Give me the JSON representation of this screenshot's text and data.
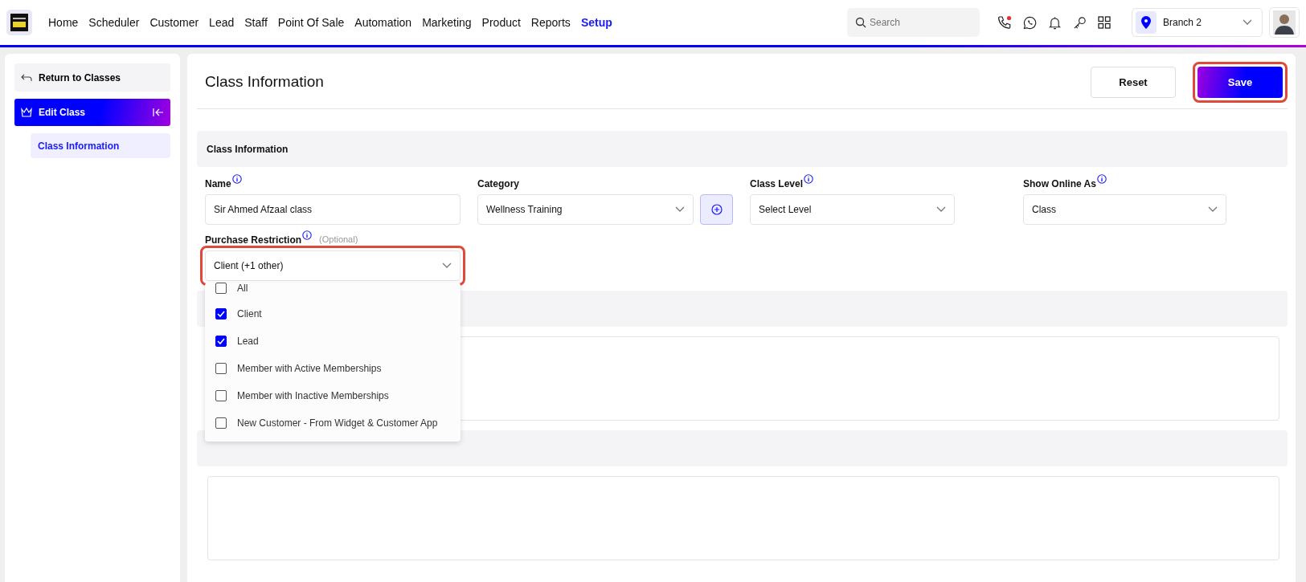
{
  "nav": {
    "items": [
      {
        "label": "Home",
        "selected": false
      },
      {
        "label": "Scheduler",
        "selected": false
      },
      {
        "label": "Customer",
        "selected": false
      },
      {
        "label": "Lead",
        "selected": false
      },
      {
        "label": "Staff",
        "selected": false
      },
      {
        "label": "Point Of Sale",
        "selected": false
      },
      {
        "label": "Automation",
        "selected": false
      },
      {
        "label": "Marketing",
        "selected": false
      },
      {
        "label": "Product",
        "selected": false
      },
      {
        "label": "Reports",
        "selected": false
      },
      {
        "label": "Setup",
        "selected": true
      }
    ],
    "search": {
      "placeholder": "Search"
    },
    "call_notification": true,
    "branch": "Branch 2"
  },
  "sidebar": {
    "back": "Return to Classes",
    "section": "Edit Class",
    "items": [
      {
        "label": "Class Information",
        "selected": true
      }
    ]
  },
  "page": {
    "title": "Class Information",
    "buttons": [
      {
        "label": "Reset",
        "kind": "secondary"
      },
      {
        "label": "Save",
        "kind": "primary",
        "highlighted": true
      }
    ]
  },
  "form": {
    "section": "Class Information",
    "fields": [
      {
        "label": "Name",
        "info": true,
        "kind": "text",
        "value": "Sir Ahmed Afzaal class"
      },
      {
        "label": "Category",
        "info": false,
        "kind": "select-add",
        "value": "Wellness Training"
      },
      {
        "label": "Class Level",
        "info": true,
        "kind": "select",
        "value": "Select Level"
      },
      {
        "label": "Show Online As",
        "info": true,
        "kind": "select",
        "value": "Class"
      }
    ],
    "restriction": {
      "label": "Purchase Restriction",
      "info": true,
      "note": "(Optional)",
      "value": "Client (+1 other)",
      "highlighted": true,
      "expanded": true,
      "options": [
        {
          "label": "All",
          "checked": false
        },
        {
          "label": "Client",
          "checked": true
        },
        {
          "label": "Lead",
          "checked": true
        },
        {
          "label": "Member with Active Memberships",
          "checked": false
        },
        {
          "label": "Member with Inactive Memberships",
          "checked": false
        },
        {
          "label": "New Customer - From Widget & Customer App",
          "checked": false
        }
      ]
    }
  }
}
